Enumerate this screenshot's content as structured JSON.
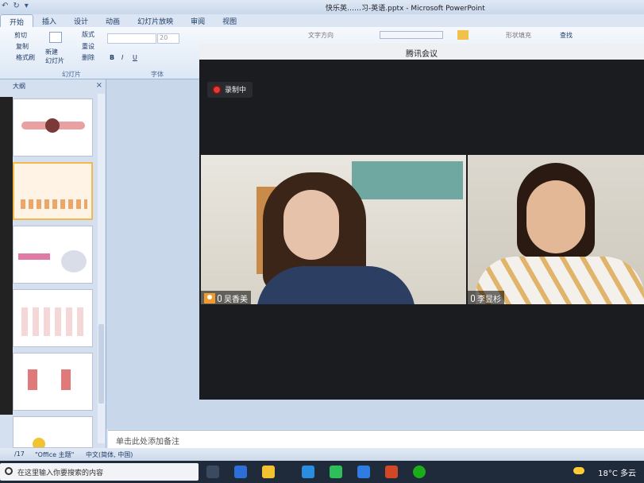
{
  "window": {
    "title": "快乐英……习-英语.pptx - Microsoft PowerPoint"
  },
  "ribbon_tabs": [
    {
      "label": "开始"
    },
    {
      "label": "插入"
    },
    {
      "label": "设计"
    },
    {
      "label": "动画"
    },
    {
      "label": "幻灯片放映"
    },
    {
      "label": "审阅"
    },
    {
      "label": "视图"
    }
  ],
  "ribbon": {
    "cut": "剪切",
    "copy": "复制",
    "format_painter": "格式刷",
    "new_slide": "新建\n幻灯片",
    "layout": "版式",
    "reset": "重设",
    "delete": "删除",
    "group_slides": "幻灯片",
    "group_font": "字体",
    "font_size": "20",
    "text_direction": "文字方向",
    "shape_fill": "形状填充",
    "find": "查找"
  },
  "panel": {
    "tab": "大纲"
  },
  "notes": {
    "placeholder": "单击此处添加备注"
  },
  "status": {
    "slide": "/17",
    "theme": "\"Office 主题\"",
    "lang": "中文(简体, 中国)"
  },
  "meeting": {
    "title": "腾讯会议",
    "recording": "录制中",
    "participants": [
      {
        "name": "吴香美",
        "host": true
      },
      {
        "name": "李昱杉",
        "host": false
      }
    ]
  },
  "taskbar": {
    "search_placeholder": "在这里输入你要搜索的内容",
    "temperature": "18°C",
    "weather": "多云"
  }
}
